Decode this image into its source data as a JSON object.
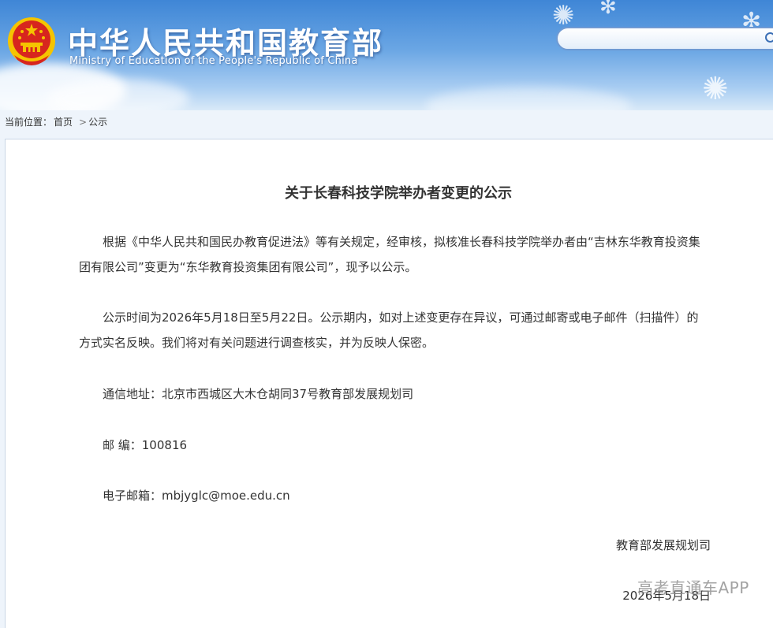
{
  "header": {
    "title": "中华人民共和国教育部",
    "subtitle": "Ministry of Education of the People's Republic of China",
    "search_placeholder": ""
  },
  "breadcrumb": {
    "label": "当前位置：",
    "home": "首页",
    "separator": ">",
    "current": "公示"
  },
  "article": {
    "title": "关于长春科技学院举办者变更的公示",
    "paragraph1": "根据《中华人民共和国民办教育促进法》等有关规定，经审核，拟核准长春科技学院举办者由“吉林东华教育投资集团有限公司”变更为“东华教育投资集团有限公司”，现予以公示。",
    "paragraph2": "公示时间为2026年5月18日至5月22日。公示期内，如对上述变更存在异议，可通过邮寄或电子邮件（扫描件）的方式实名反映。我们将对有关问题进行调查核实，并为反映人保密。",
    "address": "通信地址：北京市西城区大木仓胡同37号教育部发展规划司",
    "postcode": "邮 编：100816",
    "email": "电子邮箱：mbjyglc@moe.edu.cn",
    "signer": "教育部发展规划司",
    "date": "2026年5月18日"
  },
  "watermark": "高考直通车APP",
  "colors": {
    "header_top": "#3f86d6",
    "header_bottom": "#d9e9f8",
    "emblem_red": "#d7261e",
    "emblem_gold": "#f5c400"
  }
}
